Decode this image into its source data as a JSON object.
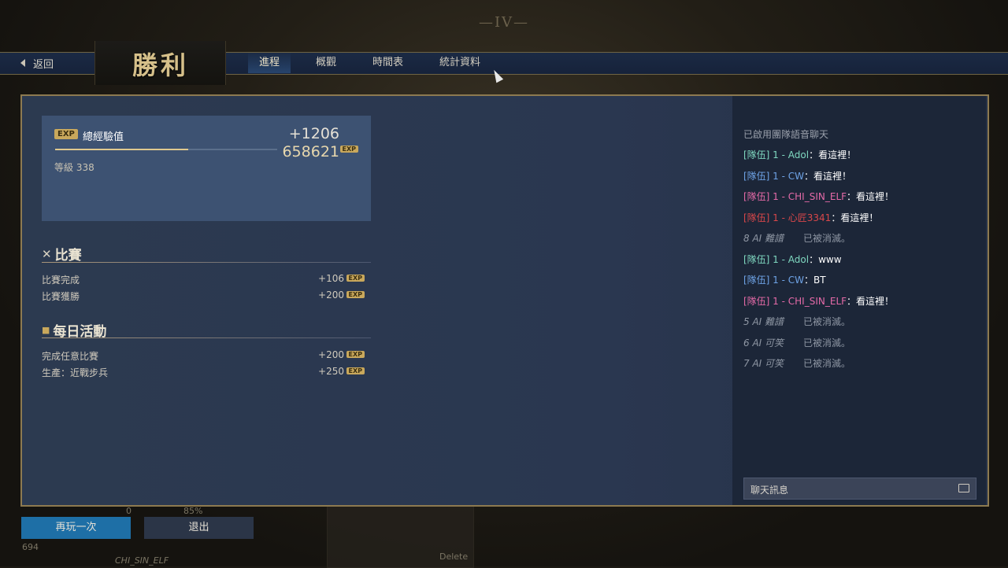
{
  "background": {
    "top_label": "—IV—",
    "hud_left_value": "694",
    "hud_percent": "85%",
    "hud_zero": "0",
    "hud_player": "CHI_SIN_ELF",
    "hud_delete": "Delete"
  },
  "header": {
    "back_label": "返回",
    "title": "勝利",
    "tabs": [
      {
        "label": "進程",
        "active": true
      },
      {
        "label": "概觀",
        "active": false
      },
      {
        "label": "時間表",
        "active": false
      },
      {
        "label": "統計資料",
        "active": false
      }
    ]
  },
  "exp": {
    "badge": "EXP",
    "label": "總經驗值",
    "gain": "+1206",
    "total": "658621",
    "level": "等級 338",
    "progress_fraction": 0.6
  },
  "match": {
    "title": "比賽",
    "rows": [
      {
        "label": "比賽完成",
        "value": "+106"
      },
      {
        "label": "比賽獲勝",
        "value": "+200"
      }
    ]
  },
  "daily": {
    "title": "每日活動",
    "rows": [
      {
        "label": "完成任意比賽",
        "value": "+200"
      },
      {
        "label": "生產：近戰步兵",
        "value": "+250"
      }
    ]
  },
  "chat": {
    "header": "已啟用團隊語音聊天",
    "lines": [
      {
        "prefix": "[隊伍] 1 - ",
        "name": "Adol",
        "color": "#7fd8c0",
        "message": "：看這裡！"
      },
      {
        "prefix": "[隊伍] 1 - ",
        "name": "CW",
        "color": "#6ea3e6",
        "message": "：看這裡！"
      },
      {
        "prefix": "[隊伍] 1 - ",
        "name": "CHI_SIN_ELF",
        "color": "#e56aa8",
        "message": "：看這裡！"
      },
      {
        "prefix": "[隊伍] 1 - ",
        "name": "心匠3341",
        "color": "#d9474a",
        "message": "：看這裡！"
      },
      {
        "system_name": "8 AI 難譜",
        "system_msg": "已被消滅。"
      },
      {
        "prefix": "[隊伍] 1 - ",
        "name": "Adol",
        "color": "#7fd8c0",
        "message": "：www"
      },
      {
        "prefix": "[隊伍] 1 - ",
        "name": "CW",
        "color": "#6ea3e6",
        "message": "：BT"
      },
      {
        "prefix": "[隊伍] 1 - ",
        "name": "CHI_SIN_ELF",
        "color": "#e56aa8",
        "message": "：看這裡！"
      },
      {
        "system_name": "5 AI 難譜",
        "system_msg": "已被消滅。"
      },
      {
        "system_name": "6 AI 可笑",
        "system_msg": "已被消滅。"
      },
      {
        "system_name": "7 AI 可笑",
        "system_msg": "已被消滅。"
      }
    ],
    "input_placeholder": "聊天訊息"
  },
  "buttons": {
    "play_again": "再玩一次",
    "exit": "退出"
  },
  "colors": {
    "accent_gold": "#c9a85c",
    "primary_button": "#1e6fa6",
    "panel_border": "#8d7a50"
  }
}
